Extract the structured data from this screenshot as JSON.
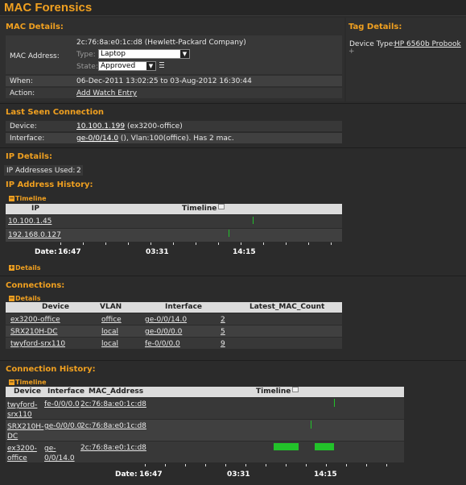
{
  "page": {
    "title": "MAC Forensics"
  },
  "mac_details": {
    "heading": "MAC Details:",
    "mac_address_label": "MAC Address:",
    "mac_address_value": "2c:76:8a:e0:1c:d8 (Hewlett-Packard Company)",
    "type_label": "Type:",
    "type_value": "Laptop",
    "state_label": "State:",
    "state_value": "Approved",
    "when_label": "When:",
    "when_value": "06-Dec-2011 13:02:25 to 03-Aug-2012 16:30:44",
    "action_label": "Action:",
    "action_value": "Add Watch Entry"
  },
  "tag_details": {
    "heading": "Tag Details:",
    "device_type_label": "Device Type:",
    "device_type_value": "HP 6560b Probook",
    "plus": "+"
  },
  "last_seen": {
    "heading": "Last Seen Connection",
    "device_label": "Device:",
    "device_link": "10.100.1.199",
    "device_suffix": " (ex3200-office)",
    "interface_label": "Interface:",
    "interface_link": "ge-0/0/14.0",
    "interface_suffix": " (), Vlan:100(office). Has 2 mac."
  },
  "ip_details": {
    "heading": "IP Details:",
    "used_label": "IP Addresses Used:",
    "used_value": "2"
  },
  "ip_history": {
    "heading": "IP Address History:",
    "timeline_toggle": "Timeline",
    "col_ip": "IP",
    "col_timeline": "Timeline",
    "rows": [
      {
        "ip": "10.100.1.45"
      },
      {
        "ip": "192.168.0.127"
      }
    ],
    "date_label": "Date:",
    "ticks": [
      "16:47",
      "03:31",
      "14:15"
    ],
    "details_toggle": "Details"
  },
  "connections": {
    "heading": "Connections:",
    "details_toggle": "Details",
    "columns": [
      "Device",
      "VLAN",
      "Interface",
      "Latest_MAC_Count"
    ],
    "rows": [
      {
        "device": "ex3200-office",
        "vlan": "office",
        "interface": "ge-0/0/14.0",
        "count": "2"
      },
      {
        "device": "SRX210H-DC",
        "vlan": "local",
        "interface": "ge-0/0/0.0",
        "count": "5"
      },
      {
        "device": "twyford-srx110",
        "vlan": "local",
        "interface": "fe-0/0/0.0",
        "count": "9"
      }
    ]
  },
  "connection_history": {
    "heading": "Connection History:",
    "timeline_toggle": "Timeline",
    "columns": [
      "Device",
      "Interface",
      "MAC_Address",
      "Timeline"
    ],
    "rows": [
      {
        "device_a": "twyford-",
        "device_b": "srx110",
        "interface_a": "fe-0/0/0.0",
        "interface_b": "",
        "mac": "2c:76:8a:e0:1c:d8"
      },
      {
        "device_a": "SRX210H-",
        "device_b": "DC",
        "interface_a": "ge-0/0/0.0",
        "interface_b": "",
        "mac": "2c:76:8a:e0:1c:d8"
      },
      {
        "device_a": "ex3200-",
        "device_b": "office",
        "interface_a": "ge-",
        "interface_b": "0/0/14.0",
        "mac": "2c:76:8a:e0:1c:d8"
      }
    ],
    "date_label": "Date:",
    "ticks": [
      "16:47",
      "03:31",
      "14:15"
    ]
  },
  "colors": {
    "accent": "#f0a020",
    "timeline_mark": "#22c22a",
    "background": "#2b2b2b"
  }
}
